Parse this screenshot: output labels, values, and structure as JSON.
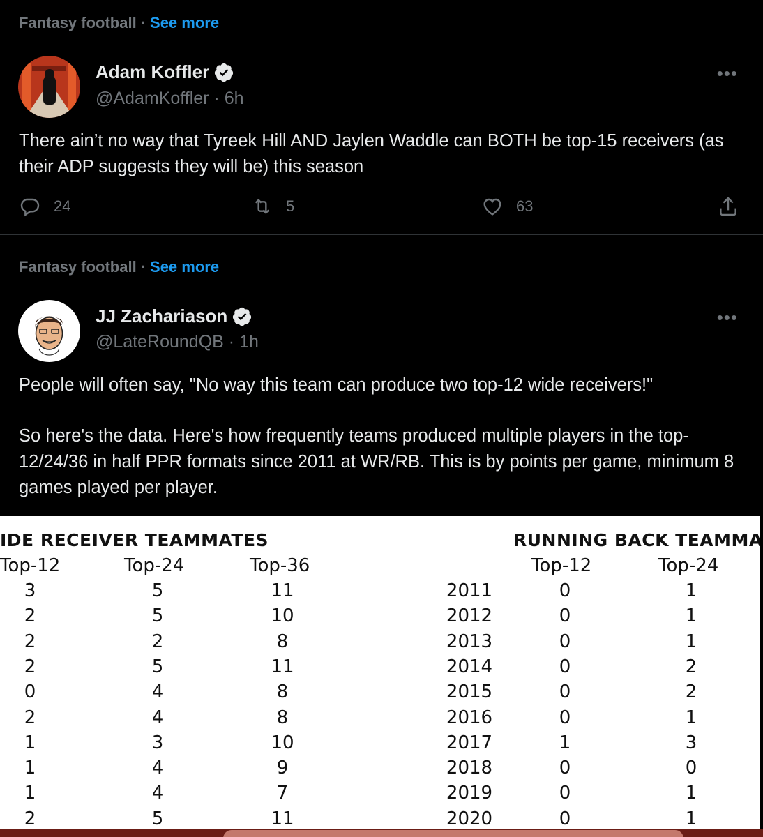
{
  "tweets": [
    {
      "context_topic": "Fantasy football",
      "context_sep": "·",
      "see_more": "See more",
      "name": "Adam Koffler",
      "handle": "@AdamKoffler",
      "time_sep": "·",
      "time": "6h",
      "more": "•••",
      "text": "There ain’t no way that Tyreek Hill AND Jaylen Waddle can BOTH be top-15 receivers (as their ADP suggests they will be) this season",
      "replies": "24",
      "retweets": "5",
      "likes": "63"
    },
    {
      "context_topic": "Fantasy football",
      "context_sep": "·",
      "see_more": "See more",
      "name": "JJ Zachariason",
      "handle": "@LateRoundQB",
      "time_sep": "·",
      "time": "1h",
      "more": "•••",
      "text_p1": "People will often say, \"No way this team can produce two top-12 wide receivers!\"",
      "text_p2": "So here's the data. Here's how frequently teams produced multiple players in the top-12/24/36 in half PPR formats since 2011 at WR/RB. This is by points per game, minimum 8 games played per player."
    }
  ],
  "table": {
    "wr_title": "IDE RECEIVER TEAMMATES",
    "rb_title": "RUNNING BACK TEAMMA",
    "wr_headers": [
      "Top-12",
      "Top-24",
      "Top-36"
    ],
    "rb_headers": [
      "Top-12",
      "Top-24"
    ],
    "years": [
      "2011",
      "2012",
      "2013",
      "2014",
      "2015",
      "2016",
      "2017",
      "2018",
      "2019",
      "2020"
    ],
    "wr_top12": [
      "3",
      "2",
      "2",
      "2",
      "0",
      "2",
      "1",
      "1",
      "1",
      "2"
    ],
    "wr_top24": [
      "5",
      "5",
      "2",
      "5",
      "4",
      "4",
      "3",
      "4",
      "4",
      "5"
    ],
    "wr_top36": [
      "11",
      "10",
      "8",
      "11",
      "8",
      "8",
      "10",
      "9",
      "7",
      "11"
    ],
    "rb_top12": [
      "0",
      "0",
      "0",
      "0",
      "0",
      "0",
      "1",
      "0",
      "0",
      "0"
    ],
    "rb_top24": [
      "1",
      "1",
      "1",
      "2",
      "2",
      "1",
      "3",
      "0",
      "1",
      "1"
    ]
  },
  "colors": {
    "background": "#000000",
    "text_primary": "#e7e9ea",
    "text_secondary": "#71767b",
    "link": "#1d9bf0",
    "verified_badge": "#e7e9ea"
  }
}
